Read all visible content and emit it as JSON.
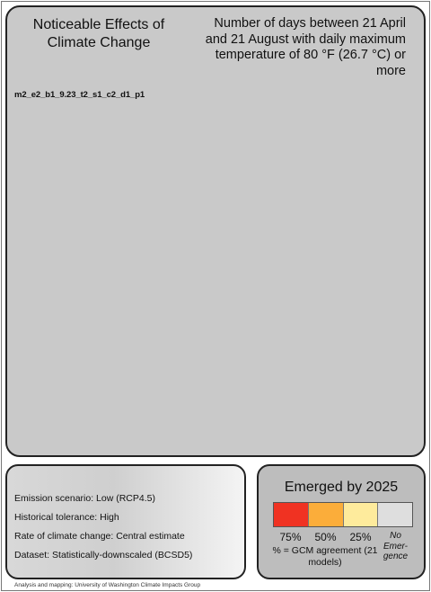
{
  "header": {
    "title": "Noticeable Effects of Climate Change",
    "description": "Number of days between 21 April and 21 August with daily maximum temperature of 80 °F (26.7 °C) or more",
    "map_code": "m2_e2_b1_9.23_t2_s1_c2_d1_p1"
  },
  "meta": {
    "items": [
      "Emission scenario: Low (RCP4.5)",
      "Historical tolerance: High",
      "Rate of climate change: Central estimate",
      "Dataset: Statistically-downscaled (BCSD5)"
    ]
  },
  "legend": {
    "title": "Emerged by 2025",
    "categories": [
      {
        "label": "75%",
        "color": "#f03222"
      },
      {
        "label": "50%",
        "color": "#fbad3a"
      },
      {
        "label": "25%",
        "color": "#feeb9c"
      },
      {
        "label": "No Emer- gence",
        "color": "#dedede"
      }
    ],
    "note": "% = GCM agreement (21 models)"
  },
  "footer": {
    "credit": "Analysis and mapping: University of Washington Climate Impacts Group"
  },
  "colors": {
    "panel_background": "#c9c9c9",
    "legend_background": "#bdbdbd",
    "border": "#222222"
  }
}
